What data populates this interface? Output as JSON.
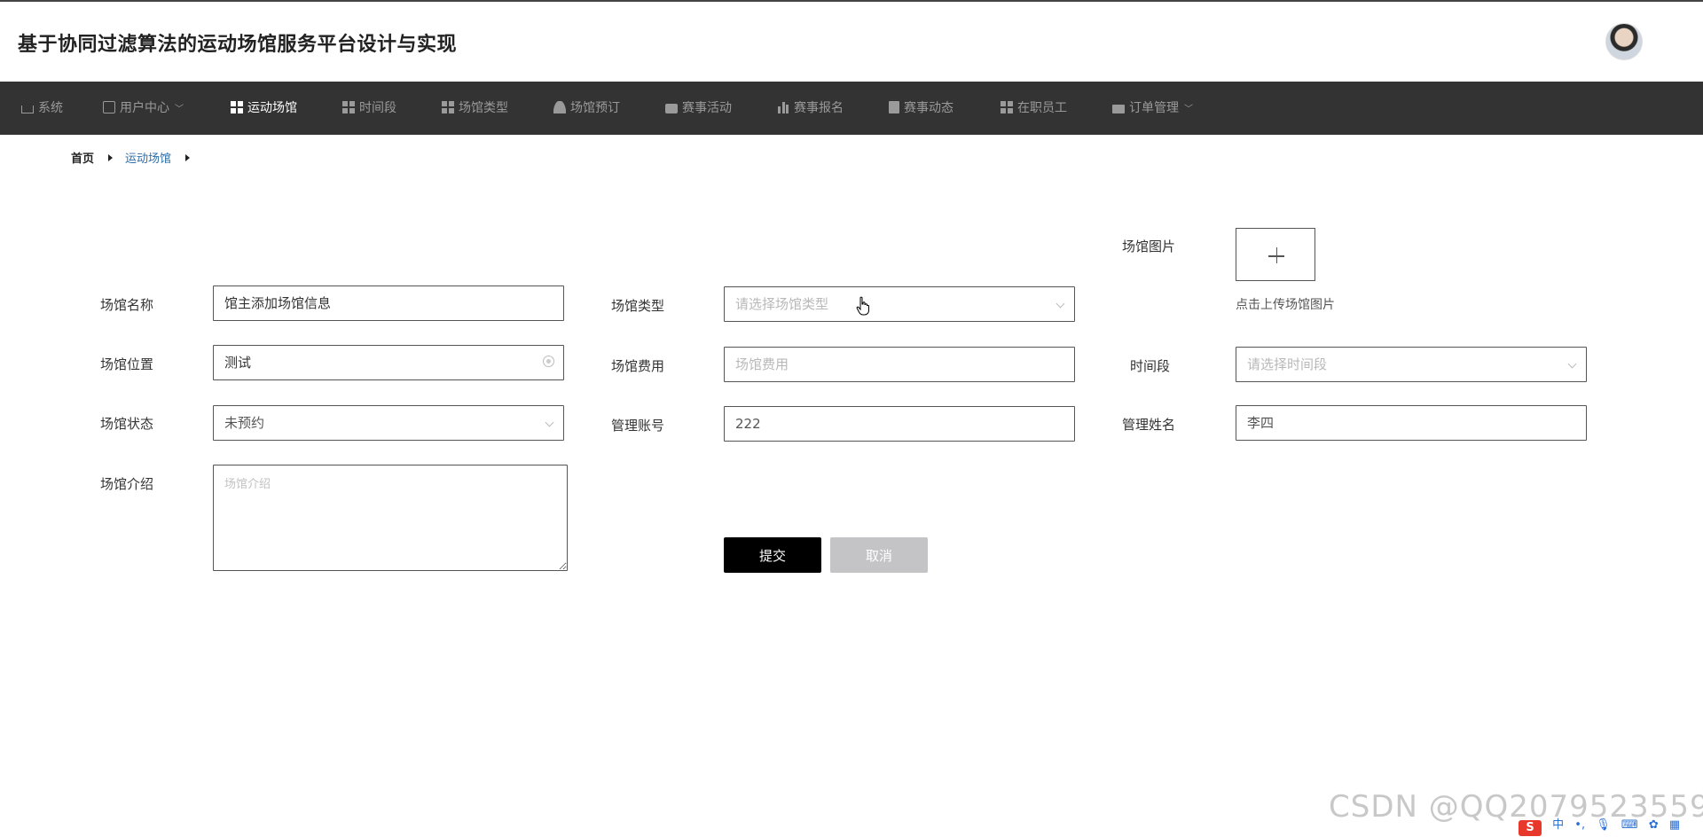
{
  "header": {
    "site_title": "基于协同过滤算法的运动场馆服务平台设计与实现"
  },
  "nav": {
    "items": [
      {
        "label": "系统",
        "icon": "home-icon"
      },
      {
        "label": "用户中心",
        "icon": "card-icon",
        "has_dropdown": true
      },
      {
        "label": "运动场馆",
        "icon": "grid-icon",
        "active": true
      },
      {
        "label": "时间段",
        "icon": "grid-icon"
      },
      {
        "label": "场馆类型",
        "icon": "grid-icon"
      },
      {
        "label": "场馆预订",
        "icon": "user-icon"
      },
      {
        "label": "赛事活动",
        "icon": "message-icon"
      },
      {
        "label": "赛事报名",
        "icon": "bar-chart-icon"
      },
      {
        "label": "赛事动态",
        "icon": "clipboard-icon"
      },
      {
        "label": "在职员工",
        "icon": "grid-icon"
      },
      {
        "label": "订单管理",
        "icon": "truck-icon",
        "has_dropdown": true
      }
    ]
  },
  "breadcrumb": {
    "home": "首页",
    "current": "运动场馆"
  },
  "form": {
    "venue_name": {
      "label": "场馆名称",
      "value": "馆主添加场馆信息"
    },
    "venue_type": {
      "label": "场馆类型",
      "placeholder": "请选择场馆类型"
    },
    "venue_image": {
      "label": "场馆图片",
      "hint": "点击上传场馆图片"
    },
    "venue_location": {
      "label": "场馆位置",
      "value": "测试"
    },
    "venue_fee": {
      "label": "场馆费用",
      "placeholder": "场馆费用"
    },
    "time_slot": {
      "label": "时间段",
      "placeholder": "请选择时间段"
    },
    "venue_status": {
      "label": "场馆状态",
      "value": "未预约"
    },
    "manager_account": {
      "label": "管理账号",
      "value": "222"
    },
    "manager_name": {
      "label": "管理姓名",
      "value": "李四"
    },
    "venue_intro": {
      "label": "场馆介绍",
      "placeholder": "场馆介绍"
    },
    "submit_label": "提交",
    "cancel_label": "取消"
  },
  "overlay": {
    "watermark": "CSDN @QQ2079523559",
    "ime_logo": "S",
    "ime_mode": "中"
  },
  "colors": {
    "navbar_bg": "#333333",
    "nav_active": "#ffffff",
    "nav_inactive": "#9a9a9a",
    "breadcrumb_current": "#2d6ea6",
    "submit_bg": "#000000",
    "cancel_bg": "#c4c4c6"
  }
}
